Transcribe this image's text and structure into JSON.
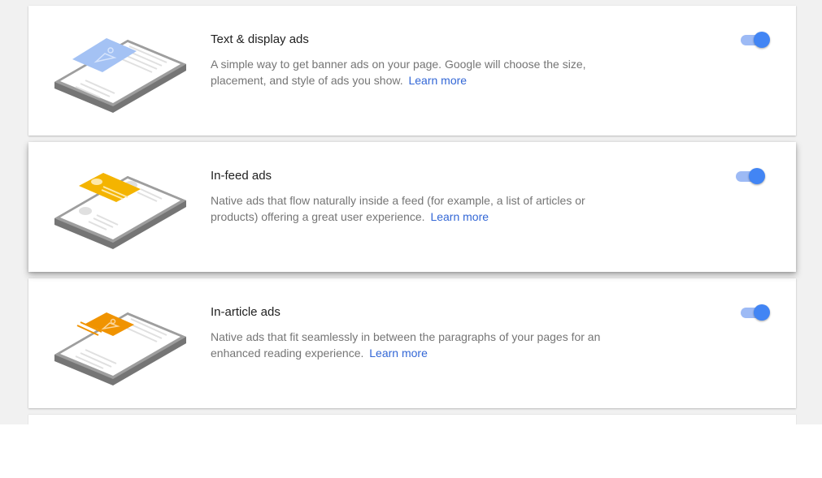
{
  "ad_types": [
    {
      "title": "Text & display ads",
      "description": "A simple way to get banner ads on your page. Google will choose the size, placement, and style of ads you show.",
      "link": "Learn more",
      "enabled": true,
      "accent_color": "#a4c2f4"
    },
    {
      "title": "In-feed ads",
      "description": "Native ads that flow naturally inside a feed (for example, a list of articles or products) offering a great user experience.",
      "link": "Learn more",
      "enabled": true,
      "accent_color": "#f4b400"
    },
    {
      "title": "In-article ads",
      "description": "Native ads that fit seamlessly in between the paragraphs of your pages for an enhanced reading experience.",
      "link": "Learn more",
      "enabled": true,
      "accent_color": "#f09300"
    }
  ],
  "colors": {
    "toggle_on_knob": "#4285f4",
    "toggle_on_track": "#9dbaf5",
    "link": "#3367d6"
  },
  "icons": [
    "phone-banner-ad-icon",
    "phone-infeed-ad-icon",
    "phone-inarticle-ad-icon"
  ]
}
